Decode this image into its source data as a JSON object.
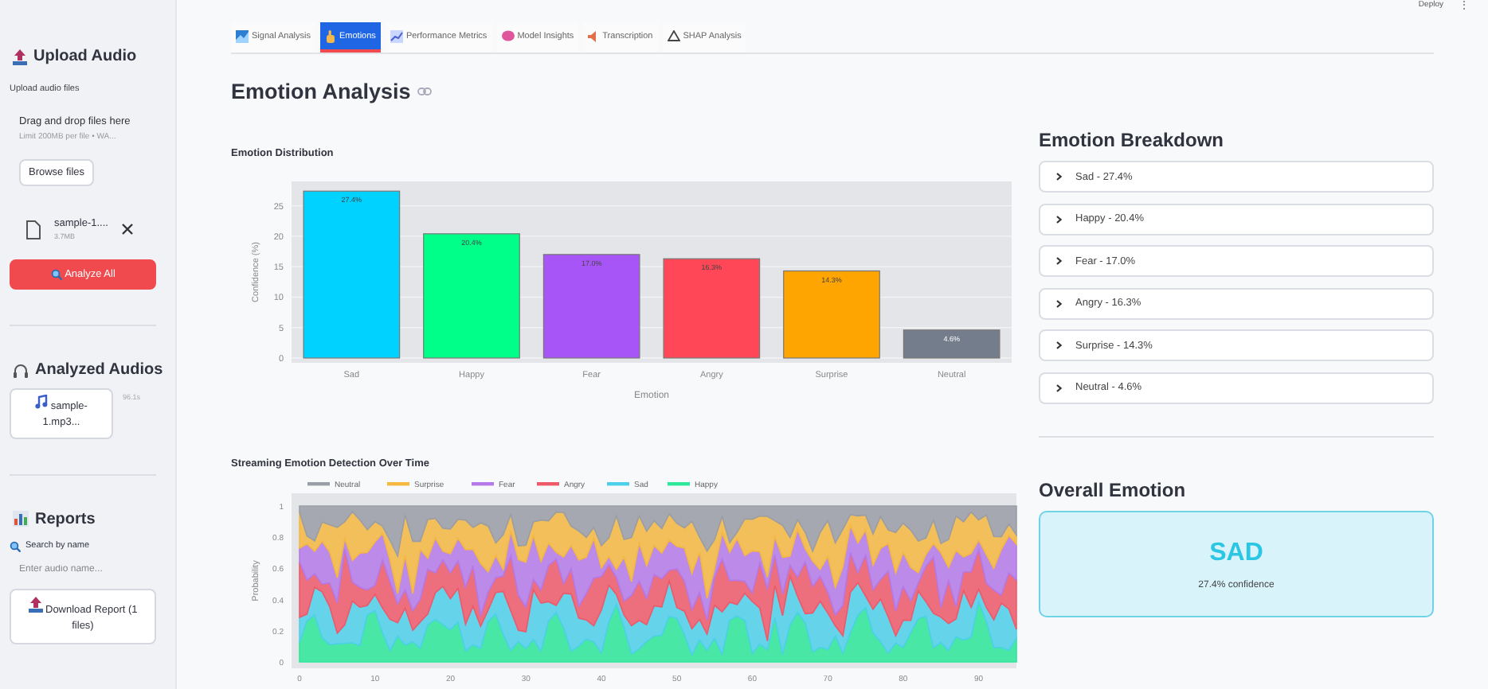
{
  "top_bar": {
    "deploy": "Deploy",
    "menu": "⋮"
  },
  "sidebar": {
    "upload": {
      "heading": "Upload Audio",
      "label": "Upload audio files",
      "drop_text": "Drag and drop files here",
      "limit": "Limit 200MB per file • WA...",
      "browse_button": "Browse files",
      "files": [
        {
          "name": "sample-1....",
          "size": "3.7MB"
        }
      ],
      "analyze_button": "Analyze All"
    },
    "analyzed": {
      "heading": "Analyzed Audios",
      "items": [
        {
          "label": "sample-1.mp3...",
          "duration": "96.1s"
        }
      ]
    },
    "reports": {
      "heading": "Reports",
      "search_label": "Search by name",
      "search": {
        "placeholder": "Enter audio name..."
      },
      "download_button": "Download Report (1 files)"
    }
  },
  "tabs": [
    {
      "label": "Signal Analysis",
      "selected": false
    },
    {
      "label": "Emotions",
      "selected": true
    },
    {
      "label": "Performance Metrics",
      "selected": false
    },
    {
      "label": "Model Insights",
      "selected": false
    },
    {
      "label": "Transcription",
      "selected": false
    },
    {
      "label": "SHAP Analysis",
      "selected": false
    }
  ],
  "page_title": "Emotion Analysis",
  "distribution": {
    "title": "Emotion Distribution",
    "chart_data": {
      "type": "bar",
      "xlabel": "Emotion",
      "ylabel": "Confidence (%)",
      "categories": [
        "Sad",
        "Happy",
        "Fear",
        "Angry",
        "Surprise",
        "Neutral"
      ],
      "values": [
        27.4,
        20.4,
        17.0,
        16.3,
        14.3,
        4.6
      ],
      "colors": [
        "#00d2ff",
        "#00ff88",
        "#a855f7",
        "#ff4757",
        "#ffa502",
        "#747d8c"
      ],
      "value_labels": [
        "27.4%",
        "20.4%",
        "17.0%",
        "16.3%",
        "14.3%",
        "4.6%"
      ],
      "ylim": [
        0,
        29
      ],
      "yticks": [
        0,
        5,
        10,
        15,
        20,
        25
      ],
      "grid": true
    }
  },
  "streaming": {
    "title": "Streaming Emotion Detection Over Time",
    "ylabel": "Probability",
    "legend": [
      {
        "label": "Neutral",
        "color": "#9a9ea6"
      },
      {
        "label": "Surprise",
        "color": "#f5b942"
      },
      {
        "label": "Fear",
        "color": "#b57ae8"
      },
      {
        "label": "Angry",
        "color": "#ef5a6a"
      },
      {
        "label": "Sad",
        "color": "#4fd0ea"
      },
      {
        "label": "Happy",
        "color": "#2ee89a"
      }
    ],
    "yticks": [
      "1",
      "0.8",
      "0.6",
      "0.4",
      "0.2",
      "0"
    ],
    "xticks": [
      "0",
      "10",
      "20",
      "30",
      "40",
      "50",
      "60",
      "70",
      "80",
      "90"
    ]
  },
  "breakdown": {
    "heading": "Emotion Breakdown",
    "items": [
      {
        "label": "Sad - 27.4%",
        "expanded": false
      },
      {
        "label": "Happy - 20.4%",
        "expanded": false
      },
      {
        "label": "Fear - 17.0%",
        "expanded": false
      },
      {
        "label": "Angry - 16.3%",
        "expanded": false
      },
      {
        "label": "Surprise - 14.3%",
        "expanded": false
      },
      {
        "label": "Neutral - 4.6%",
        "expanded": false
      }
    ]
  },
  "overall": {
    "heading": "Overall Emotion",
    "emotion": "SAD",
    "confidence": "27.4% confidence"
  }
}
